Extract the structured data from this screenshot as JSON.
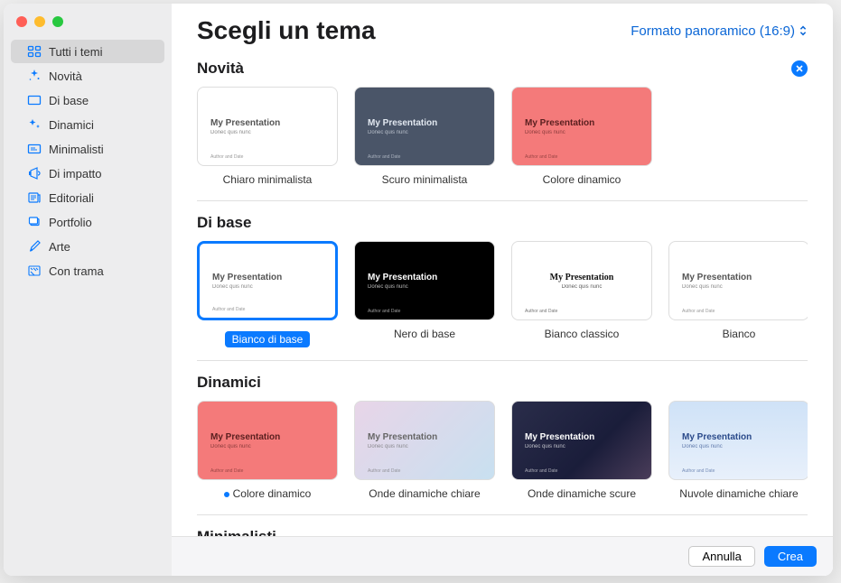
{
  "header": {
    "title": "Scegli un tema",
    "format_label": "Formato panoramico (16:9)"
  },
  "sidebar": {
    "items": [
      {
        "label": "Tutti i temi",
        "icon": "grid",
        "selected": true
      },
      {
        "label": "Novità",
        "icon": "sparkle",
        "selected": false
      },
      {
        "label": "Di base",
        "icon": "rect",
        "selected": false
      },
      {
        "label": "Dinamici",
        "icon": "sparkle2",
        "selected": false
      },
      {
        "label": "Minimalisti",
        "icon": "text",
        "selected": false
      },
      {
        "label": "Di impatto",
        "icon": "megaphone",
        "selected": false
      },
      {
        "label": "Editoriali",
        "icon": "news",
        "selected": false
      },
      {
        "label": "Portfolio",
        "icon": "folder",
        "selected": false
      },
      {
        "label": "Arte",
        "icon": "paint",
        "selected": false
      },
      {
        "label": "Con trama",
        "icon": "texture",
        "selected": false
      }
    ]
  },
  "sections": [
    {
      "title": "Novità",
      "closable": true,
      "items": [
        {
          "label": "Chiaro minimalista",
          "cls": "thumb-white",
          "title": "My Presentation",
          "sub": "Donec quis nunc",
          "author": "Author and Date"
        },
        {
          "label": "Scuro minimalista",
          "cls": "thumb-dark",
          "title": "My Presentation",
          "sub": "Donec quis nunc",
          "author": "Author and Date"
        },
        {
          "label": "Colore dinamico",
          "cls": "thumb-red",
          "title": "My Presentation",
          "sub": "Donec quis nunc",
          "author": "Author and Date"
        }
      ]
    },
    {
      "title": "Di base",
      "closable": false,
      "items": [
        {
          "label": "Bianco di base",
          "cls": "thumb-white",
          "title": "My Presentation",
          "sub": "Donec quis nunc",
          "author": "Author and Date",
          "selected": true
        },
        {
          "label": "Nero di base",
          "cls": "thumb-black",
          "title": "My Presentation",
          "sub": "Donec quis nunc",
          "author": "Author and Date"
        },
        {
          "label": "Bianco classico",
          "cls": "thumb-classic",
          "title": "My Presentation",
          "sub": "Donec quis nunc",
          "author": "Author and Date"
        },
        {
          "label": "Bianco",
          "cls": "thumb-white",
          "title": "My Presentation",
          "sub": "Donec quis nunc",
          "author": "Author and Date"
        },
        {
          "peek": true,
          "cls": "thumb-white"
        }
      ]
    },
    {
      "title": "Dinamici",
      "closable": false,
      "items": [
        {
          "label": "Colore dinamico",
          "cls": "thumb-red",
          "title": "My Presentation",
          "sub": "Donec quis nunc",
          "author": "Author and Date",
          "dot": true
        },
        {
          "label": "Onde dinamiche chiare",
          "cls": "thumb-gradient",
          "title": "My Presentation",
          "sub": "Donec quis nunc",
          "author": "Author and Date"
        },
        {
          "label": "Onde dinamiche scure",
          "cls": "thumb-darkwave",
          "title": "My Presentation",
          "sub": "Donec quis nunc",
          "author": "Author and Date"
        },
        {
          "label": "Nuvole dinamiche chiare",
          "cls": "thumb-clouds",
          "title": "My Presentation",
          "sub": "Donec quis nunc",
          "author": "Author and Date"
        },
        {
          "peek": true,
          "cls": "thumb-darkwave"
        }
      ]
    },
    {
      "title": "Minimalisti",
      "closable": false,
      "items": []
    }
  ],
  "footer": {
    "cancel": "Annulla",
    "create": "Crea"
  }
}
